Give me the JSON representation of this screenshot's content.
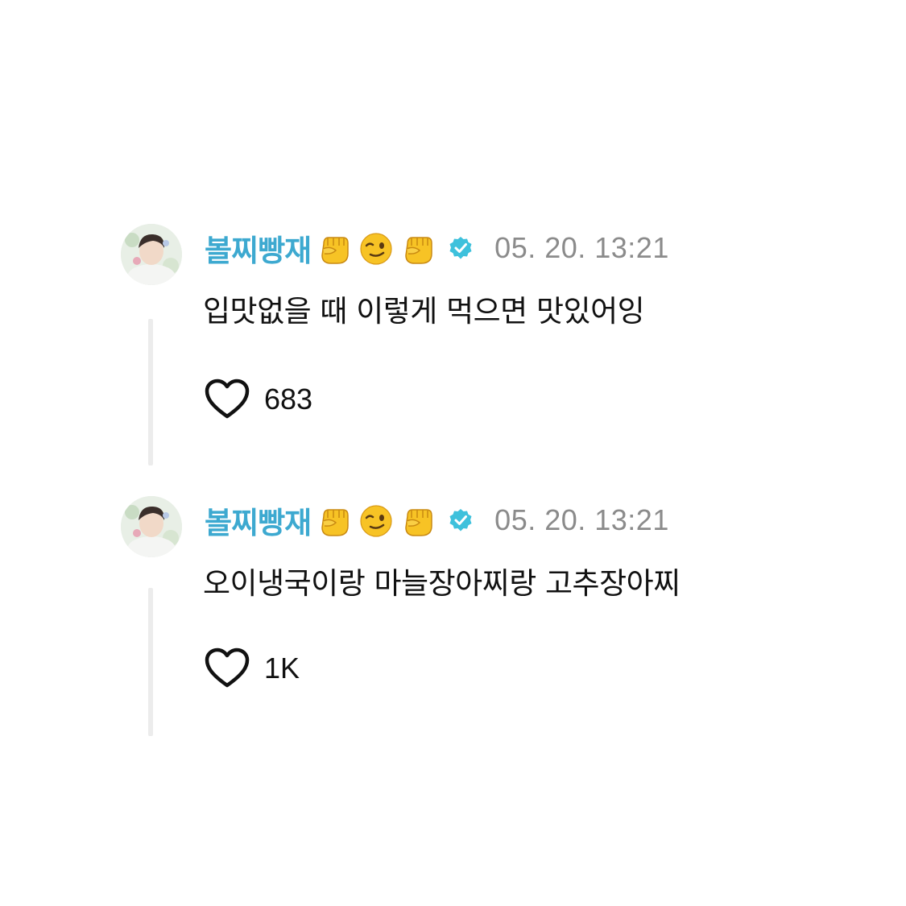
{
  "comments": [
    {
      "username": "볼찌빵재",
      "emojis": [
        "raised-fist-icon",
        "winking-face-icon",
        "raised-fist-icon"
      ],
      "verified": true,
      "timestamp": "05. 20. 13:21",
      "text": "입맛없을 때 이렇게 먹으면 맛있어잉",
      "likes": "683"
    },
    {
      "username": "볼찌빵재",
      "emojis": [
        "raised-fist-icon",
        "winking-face-icon",
        "raised-fist-icon"
      ],
      "verified": true,
      "timestamp": "05. 20. 13:21",
      "text": "오이냉국이랑 마늘장아찌랑 고추장아찌",
      "likes": "1K"
    }
  ],
  "colors": {
    "username": "#3da9d0",
    "verified_badge": "#3ec1dc",
    "timestamp": "#8b8b8b",
    "thread_line": "#ececec",
    "emoji_yellow": "#f7c325"
  }
}
